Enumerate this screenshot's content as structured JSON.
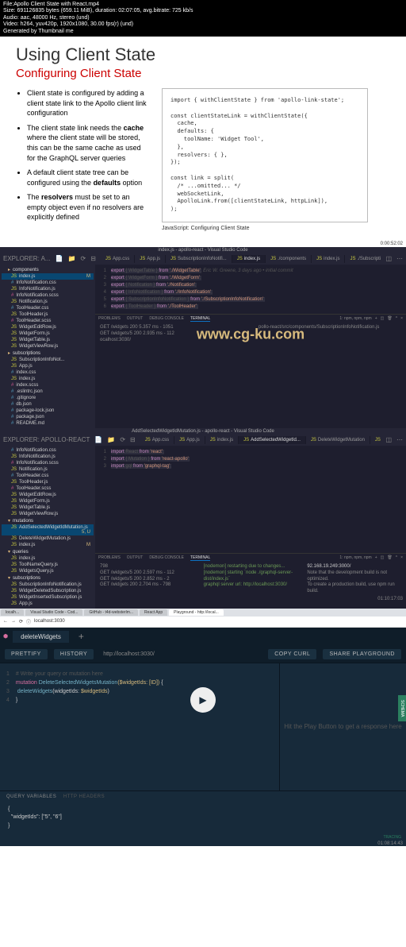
{
  "header": {
    "file": "File:Apollo Client State with React.mp4",
    "size": "Size: 691126835 bytes (659.11 MiB), duration: 02:07:05, avg.bitrate: 725 kb/s",
    "audio": "Audio: aac, 48000 Hz, stereo (und)",
    "video": "Video: h264, yuv420p, 1920x1080, 30.00 fps(r) (und)",
    "gen": "Generated by Thumbnail me"
  },
  "slide": {
    "title": "Using Client State",
    "subtitle": "Configuring Client State",
    "bullets": [
      {
        "pre": "Client state is configured by adding a client state link to the Apollo client link configuration",
        "b": "",
        "post": ""
      },
      {
        "pre": "The client state link needs the ",
        "b": "cache",
        "post": " where the client state will be stored, this can be the same cache as used for the GraphQL server queries"
      },
      {
        "pre": "A default client state tree can be configured using the ",
        "b": "defaults",
        "post": " option"
      },
      {
        "pre": "The ",
        "b": "resolvers",
        "post": " must be set to an empty object even if no resolvers are explicitly defined"
      }
    ],
    "code": "import { withClientState } from 'apollo-link-state';\n\nconst clientStateLink = withClientState({\n  cache,\n  defaults: {\n    toolName: 'Widget Tool',\n  },\n  resolvers: { },\n});\n\nconst link = split(\n  /* ...omitted... */\n  webSocketLink,\n  ApolloLink.from([clientStateLink, httpLink]),\n);",
    "caption": "JavaScript: Configuring Client State",
    "ts": "0:00:52:02"
  },
  "vscode1": {
    "title": "index.js - apollo-react - Visual Studio Code",
    "explorer_label": "EXPLORER: A...",
    "tabs": [
      "App.css",
      "App.js",
      "SubscriptionInfoNotifi...",
      "index.js",
      "./components",
      "index.js",
      "./Subscription..."
    ],
    "active_tab": 3,
    "tree_folder_components": "components",
    "tree": [
      {
        "n": "index.js",
        "t": "js",
        "sel": true,
        "m": "M"
      },
      {
        "n": "InfoNotification.css",
        "t": "css"
      },
      {
        "n": "InfoNotification.js",
        "t": "js"
      },
      {
        "n": "InfoNotification.scss",
        "t": "scss"
      },
      {
        "n": "Notification.js",
        "t": "js"
      },
      {
        "n": "ToolHeader.css",
        "t": "css"
      },
      {
        "n": "ToolHeader.js",
        "t": "js"
      },
      {
        "n": "ToolHeader.scss",
        "t": "scss"
      },
      {
        "n": "WidgetEditRow.js",
        "t": "js"
      },
      {
        "n": "WidgetForm.js",
        "t": "js"
      },
      {
        "n": "WidgetTable.js",
        "t": "js"
      },
      {
        "n": "WidgetViewRow.js",
        "t": "js"
      }
    ],
    "tree_folder_subs": "subscriptions",
    "tree2": [
      {
        "n": "SubscriptionInfoNot...",
        "t": "js"
      },
      {
        "n": "App.js",
        "t": "js"
      },
      {
        "n": "index.css",
        "t": "css"
      },
      {
        "n": "index.js",
        "t": "js"
      },
      {
        "n": "index.scss",
        "t": "scss"
      }
    ],
    "tree_root": [
      {
        "n": ".eslintrc.json",
        "t": "json"
      },
      {
        "n": ".gitignore",
        "t": "cfg"
      },
      {
        "n": "db.json",
        "t": "json"
      },
      {
        "n": "package-lock.json",
        "t": "json"
      },
      {
        "n": "package.json",
        "t": "json"
      },
      {
        "n": "README.md",
        "t": "md"
      }
    ],
    "blame": "Eric W. Greene, 3 days ago • initial commit",
    "code": [
      {
        "ln": 1,
        "t": "export { WidgetTable } from './WidgetTable';"
      },
      {
        "ln": 2,
        "t": "export { WidgetForm } from './WidgetForm';"
      },
      {
        "ln": 3,
        "t": "export { Notification } from './Notification';"
      },
      {
        "ln": 4,
        "t": "export { InfoNotification } from './InfoNotification';"
      },
      {
        "ln": 5,
        "t": "export { SubscriptionInfoNotification } from './SubscriptionInfoNotification';"
      },
      {
        "ln": 6,
        "t": "export { ToolHeader } from './ToolHeader';"
      }
    ],
    "term_tabs": [
      "PROBLEMS",
      "OUTPUT",
      "DEBUG CONSOLE",
      "TERMINAL"
    ],
    "term_dd": "1: npm, npm, npm",
    "term_lines": [
      "GET /widgets 200 5.357 ms - 1051",
      "GET /widgets/5 200 2.935 ms - 112",
      "ocalhost:3030/"
    ],
    "term_right": "pollo-react/src/components/SubscriptionInfoNotification.js",
    "watermark": "www.cg-ku.com",
    "ts": "0:00:50:51"
  },
  "vscode2": {
    "title": "AddSelectedWidgetIdMutation.js - apollo-react - Visual Studio Code",
    "explorer_label": "EXPLORER: APOLLO-REACT",
    "tabs": [
      "App.css",
      "App.js",
      "index.js",
      "AddSelectedWidgetId...",
      "DeleteWidgetMutation",
      "WidgetsQuery.js"
    ],
    "active_tab": 3,
    "tree": [
      {
        "n": "InfoNotification.css",
        "t": "css"
      },
      {
        "n": "InfoNotification.js",
        "t": "js"
      },
      {
        "n": "InfoNotification.scss",
        "t": "scss"
      },
      {
        "n": "Notification.js",
        "t": "js"
      },
      {
        "n": "ToolHeader.css",
        "t": "css"
      },
      {
        "n": "ToolHeader.js",
        "t": "js"
      },
      {
        "n": "ToolHeader.scss",
        "t": "scss"
      },
      {
        "n": "WidgetEditRow.js",
        "t": "js"
      },
      {
        "n": "WidgetForm.js",
        "t": "js"
      },
      {
        "n": "WidgetTable.js",
        "t": "js"
      },
      {
        "n": "WidgetViewRow.js",
        "t": "js"
      }
    ],
    "folder_mut": "mutations",
    "tree_mut": [
      {
        "n": "AddSelectedWidgetIdMutation.js",
        "t": "js",
        "sel": true,
        "m": "5, U"
      },
      {
        "n": "DeleteWidgetMutation.js",
        "t": "js"
      },
      {
        "n": "index.js",
        "t": "js",
        "m": "M"
      }
    ],
    "folder_q": "queries",
    "tree_q": [
      {
        "n": "index.js",
        "t": "js"
      },
      {
        "n": "ToolNameQuery.js",
        "t": "js"
      },
      {
        "n": "WidgetsQuery.js",
        "t": "js"
      }
    ],
    "folder_s": "subscriptions",
    "tree_s": [
      {
        "n": "SubscriptionInfoNotification.js",
        "t": "js"
      },
      {
        "n": "WidgetDeletedSubscription.js",
        "t": "js"
      },
      {
        "n": "WidgetInsertedSubscription.js",
        "t": "js"
      },
      {
        "n": "App.js",
        "t": "js"
      }
    ],
    "code": [
      {
        "ln": 1,
        "t": "import React from 'react';"
      },
      {
        "ln": 2,
        "t": "import { Mutation } from 'react-apollo';"
      },
      {
        "ln": 3,
        "t": "import gql from 'graphql-tag';"
      }
    ],
    "term_tabs": [
      "PROBLEMS",
      "OUTPUT",
      "DEBUG CONSOLE",
      "TERMINAL"
    ],
    "term_dd": "1: npm, npm, npm",
    "term_left": [
      "798",
      "GET /widgets/5 200 2.597 ms - 112",
      "GET /widgets/5 200 2.852 ms - 2",
      "GET /widgets 200 2.704 ms - 798"
    ],
    "term_mid": [
      "[nodemon] restarting due to changes...",
      "[nodemon] starting `node ./graphql-server-dist/index.js`",
      "graphql server url: http://localhost:3030/"
    ],
    "term_right_ip": "92.168.19.249:3000/",
    "term_right": [
      "Note that the development build is not optimized.",
      "To create a production build, use npm run build."
    ],
    "ts": "01:10:17:03"
  },
  "browser": {
    "tabs": [
      "localh...",
      "Visual Studio Code - Cod...",
      "GitHub - t4d-websterlm...",
      "React App",
      "Playground - http://local..."
    ],
    "url": "localhost:3030"
  },
  "playground": {
    "tab": "deleteWidgets",
    "prettify": "PRETTIFY",
    "history": "HISTORY",
    "url": "http://localhost:3030/",
    "copycurl": "COPY CURL",
    "share": "SHARE PLAYGROUND",
    "editor": [
      {
        "c": "# Write your query or mutation here"
      },
      {
        "k": "mutation",
        "n": " DeleteSelectedWidgetsMutation",
        "p": "($widgetIds: [ID])",
        "b": " {"
      },
      {
        "i": "  ",
        "k": "deleteWidgets",
        "p": "(widgetIds: ",
        "v": "$widgetIds",
        ")": ")"
      }
    ],
    "right_hint": "Hit the Play Button to get a response here",
    "side_tab": "SCHEMA",
    "vars_label": "QUERY VARIABLES",
    "headers_label": "HTTP HEADERS",
    "vars": "{\n  \"widgetIds\": [\"5\", \"6\"]\n}",
    "tracing": "TRACING",
    "ts": "01:08:14:43"
  }
}
